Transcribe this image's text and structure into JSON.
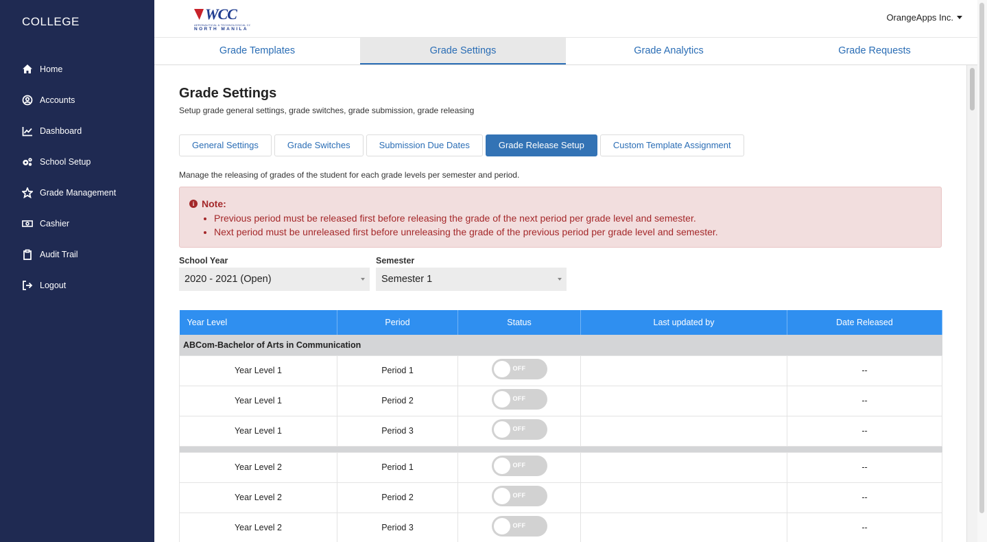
{
  "sidebar": {
    "brand": "COLLEGE",
    "items": [
      {
        "label": "Home",
        "icon": "home-icon"
      },
      {
        "label": "Accounts",
        "icon": "user-circle-icon"
      },
      {
        "label": "Dashboard",
        "icon": "chart-line-icon"
      },
      {
        "label": "School Setup",
        "icon": "gears-icon"
      },
      {
        "label": "Grade Management",
        "icon": "star-icon"
      },
      {
        "label": "Cashier",
        "icon": "money-bill-icon"
      },
      {
        "label": "Audit Trail",
        "icon": "clipboard-icon"
      },
      {
        "label": "Logout",
        "icon": "sign-out-icon"
      }
    ]
  },
  "header": {
    "logo_text": "WCC",
    "logo_subtitle": "AERONAUTICAL & TECHNOLOGICAL COLLEGE",
    "logo_location": "NORTH MANILA",
    "org_name": "OrangeApps Inc."
  },
  "main_tabs": [
    "Grade Templates",
    "Grade Settings",
    "Grade Analytics",
    "Grade Requests"
  ],
  "main_tab_active": "Grade Settings",
  "page": {
    "title": "Grade Settings",
    "description": "Setup grade general settings, grade switches, grade submission, grade releasing",
    "sub_tabs": [
      "General Settings",
      "Grade Switches",
      "Submission Due Dates",
      "Grade Release Setup",
      "Custom Template Assignment"
    ],
    "sub_tab_active": "Grade Release Setup",
    "manage_description": "Manage the releasing of grades of the student for each grade levels per semester and period."
  },
  "note": {
    "title": "Note:",
    "items": [
      "Previous period must be released first before releasing the grade of the next period per grade level and semester.",
      "Next period must be unreleased first before unreleasing the grade of the previous period per grade level and semester."
    ]
  },
  "filters": {
    "school_year_label": "School Year",
    "school_year_value": "2020 - 2021 (Open)",
    "semester_label": "Semester",
    "semester_value": "Semester 1"
  },
  "table": {
    "headers": [
      "Year Level",
      "Period",
      "Status",
      "Last updated by",
      "Date Released"
    ],
    "group": "ABCom-Bachelor of Arts in Communication",
    "rows": [
      {
        "year_level": "Year Level 1",
        "period": "Period 1",
        "status": "OFF",
        "last_updated_by": "",
        "date_released": "--"
      },
      {
        "year_level": "Year Level 1",
        "period": "Period 2",
        "status": "OFF",
        "last_updated_by": "",
        "date_released": "--"
      },
      {
        "year_level": "Year Level 1",
        "period": "Period 3",
        "status": "OFF",
        "last_updated_by": "",
        "date_released": "--"
      },
      {
        "year_level": "Year Level 2",
        "period": "Period 1",
        "status": "OFF",
        "last_updated_by": "",
        "date_released": "--"
      },
      {
        "year_level": "Year Level 2",
        "period": "Period 2",
        "status": "OFF",
        "last_updated_by": "",
        "date_released": "--"
      },
      {
        "year_level": "Year Level 2",
        "period": "Period 3",
        "status": "OFF",
        "last_updated_by": "",
        "date_released": "--"
      }
    ]
  },
  "colors": {
    "sidebar_bg": "#1f2a52",
    "accent": "#2a6db5",
    "table_header": "#2f8ff0",
    "note_bg": "#f2dede",
    "note_text": "#a4282a"
  }
}
